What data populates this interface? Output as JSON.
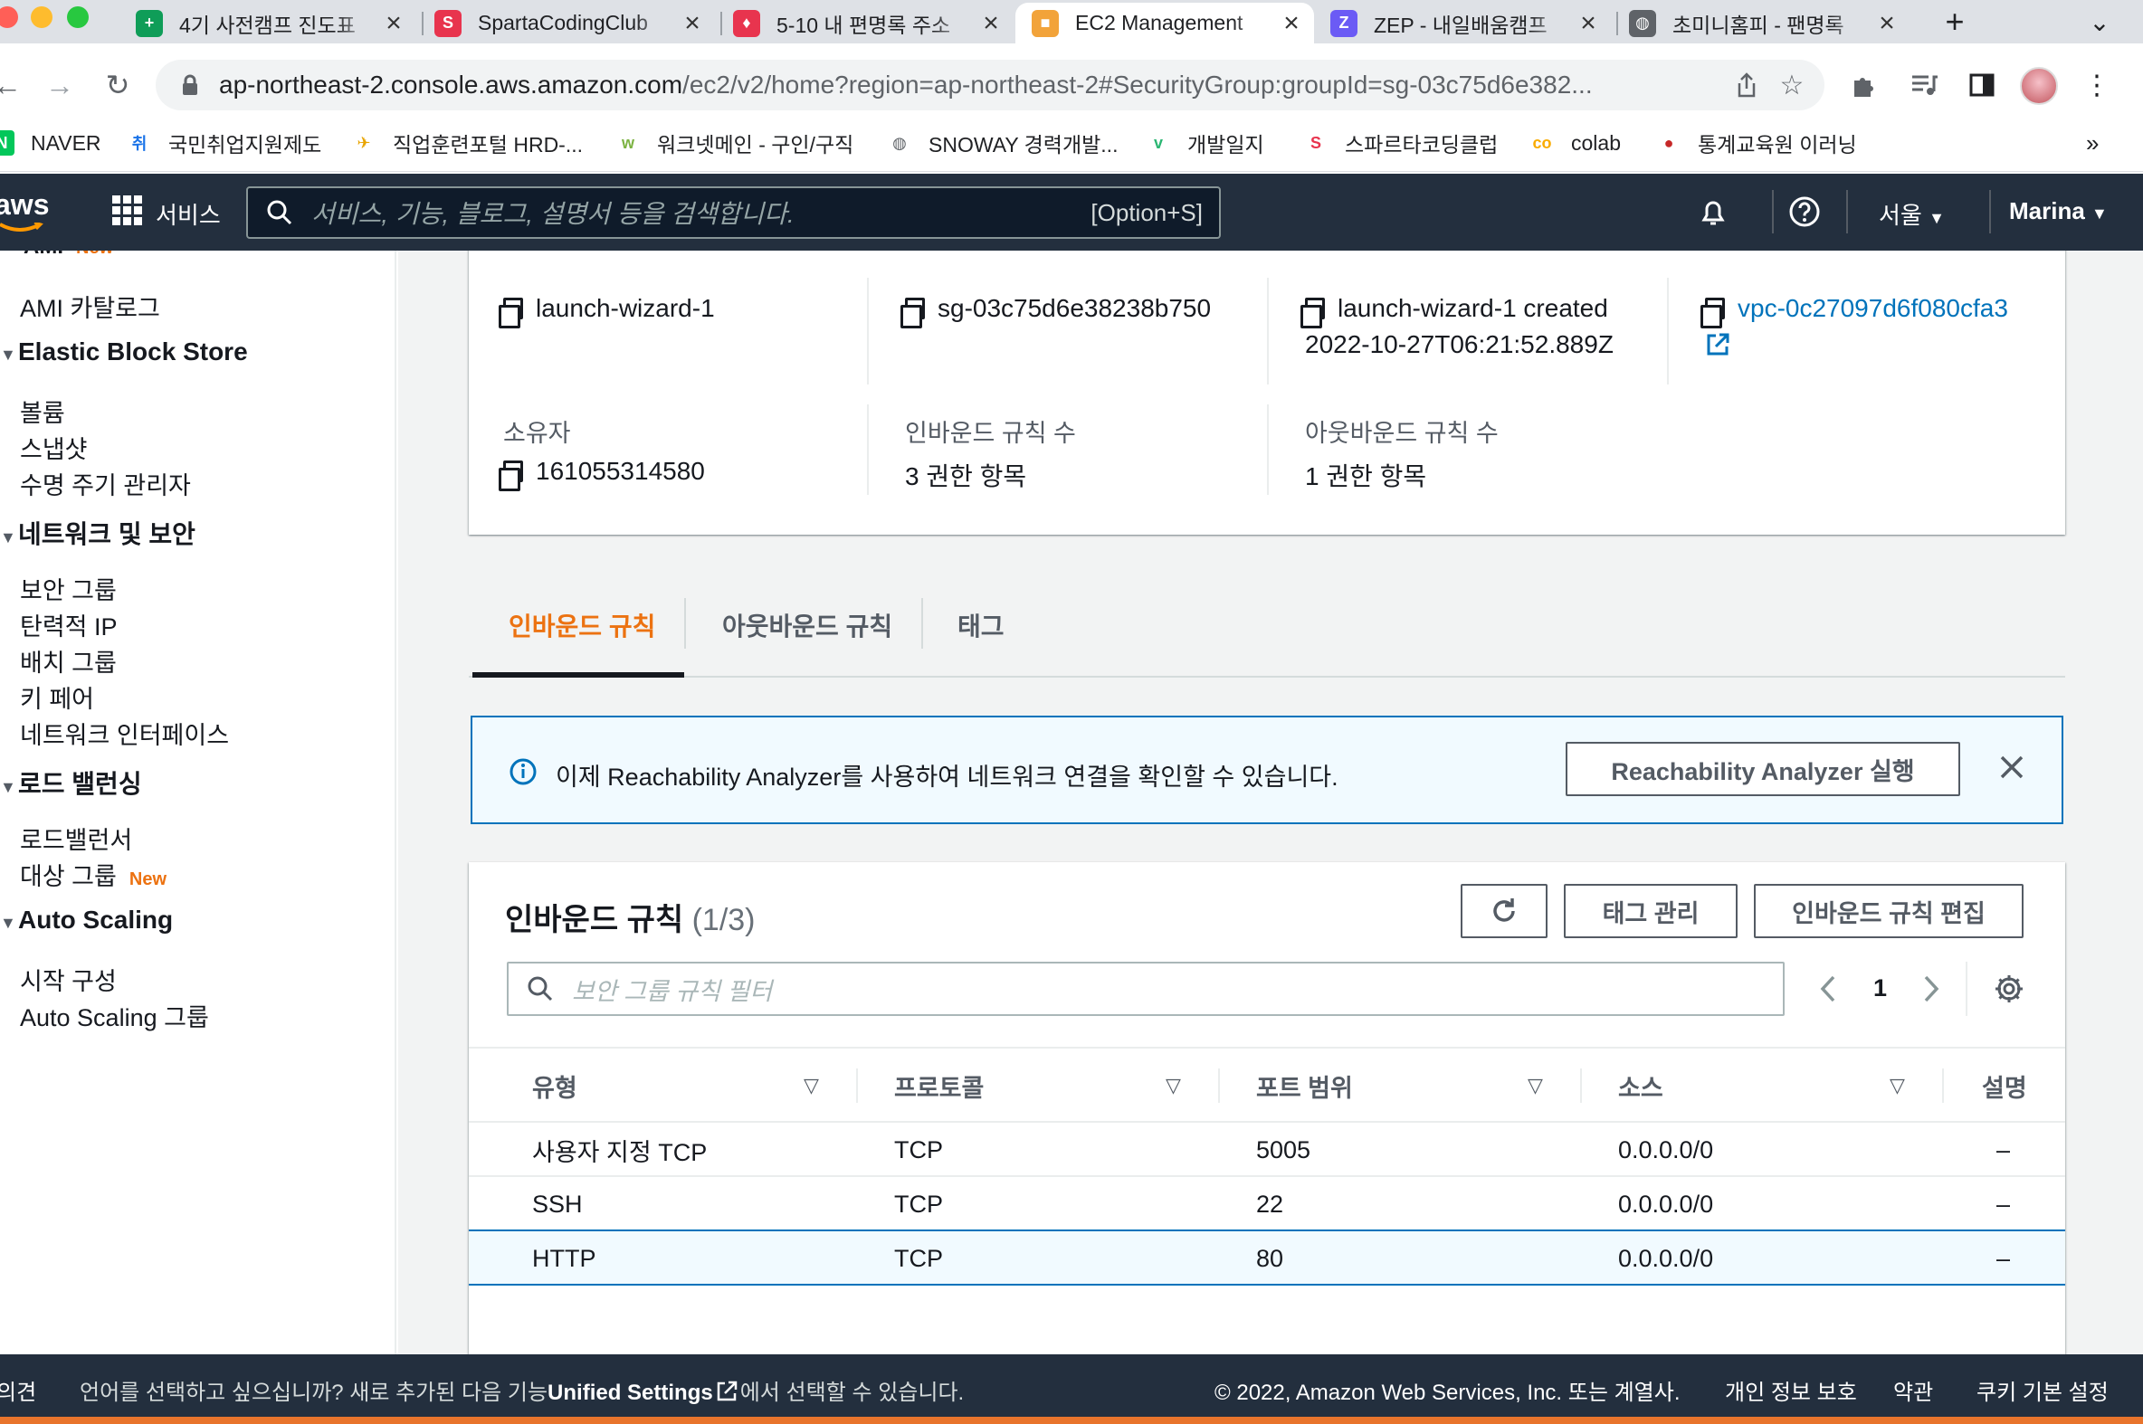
{
  "browser": {
    "tabs": [
      {
        "title": "4기 사전캠프 진도표",
        "favicon_color": "#0f9d58",
        "favicon_text": "+",
        "active": false
      },
      {
        "title": "SpartaCodingClub",
        "favicon_color": "#e8344e",
        "favicon_text": "S",
        "active": false
      },
      {
        "title": "5-10 내 편명록 주소",
        "favicon_color": "#e8344e",
        "favicon_text": "♦",
        "active": false
      },
      {
        "title": "EC2 Management",
        "favicon_color": "#f2a33a",
        "favicon_text": "■",
        "active": true
      },
      {
        "title": "ZEP - 내일배움캠프",
        "favicon_color": "#6b5bf5",
        "favicon_text": "Z",
        "active": false
      },
      {
        "title": "초미니홈피 - 팬명록",
        "favicon_color": "#5f6368",
        "favicon_text": "◍",
        "active": false
      }
    ],
    "new_tab": "+",
    "tab_menu": "⌄",
    "url_host": "ap-northeast-2.console.aws.amazon.com",
    "url_path": "/ec2/v2/home?region=ap-northeast-2#SecurityGroup:groupId=sg-03c75d6e382...",
    "bookmarks": [
      {
        "label": "NAVER",
        "icon": "N",
        "color": "#03c75a"
      },
      {
        "label": "국민취업지원제도",
        "icon": "취",
        "color": "#1a73e8"
      },
      {
        "label": "직업훈련포털 HRD-...",
        "icon": "✈",
        "color": "#e8a400"
      },
      {
        "label": "워크넷메인 - 구인/구직",
        "icon": "w",
        "color": "#7cb342"
      },
      {
        "label": "SNOWAY 경력개발...",
        "icon": "◍",
        "color": "#5f6368"
      },
      {
        "label": "개발일지",
        "icon": "v",
        "color": "#2bb673"
      },
      {
        "label": "스파르타코딩클럽",
        "icon": "S",
        "color": "#e8344e"
      },
      {
        "label": "colab",
        "icon": "co",
        "color": "#f9ab00"
      },
      {
        "label": "통계교육원 이러닝",
        "icon": "●",
        "color": "#c62828"
      }
    ],
    "bookmarks_more": "»"
  },
  "aws_nav": {
    "logo": "aws",
    "services_label": "서비스",
    "search_placeholder": "서비스, 기능, 블로그, 설명서 등을 검색합니다.",
    "search_shortcut": "[Option+S]",
    "region": "서울",
    "user": "Marina"
  },
  "sidebar": {
    "partial_top": "AMI",
    "partial_top_badge": "New",
    "items": [
      {
        "type": "item",
        "label": "AMI 카탈로그"
      },
      {
        "type": "head",
        "label": "Elastic Block Store"
      },
      {
        "type": "item",
        "label": "볼륨"
      },
      {
        "type": "item",
        "label": "스냅샷"
      },
      {
        "type": "item",
        "label": "수명 주기 관리자"
      },
      {
        "type": "head",
        "label": "네트워크 및 보안"
      },
      {
        "type": "item",
        "label": "보안 그룹"
      },
      {
        "type": "item",
        "label": "탄력적 IP"
      },
      {
        "type": "item",
        "label": "배치 그룹"
      },
      {
        "type": "item",
        "label": "키 페어"
      },
      {
        "type": "item",
        "label": "네트워크 인터페이스"
      },
      {
        "type": "head",
        "label": "로드 밸런싱"
      },
      {
        "type": "item",
        "label": "로드밸런서"
      },
      {
        "type": "item",
        "label": "대상 그룹",
        "badge": "New"
      },
      {
        "type": "head",
        "label": "Auto Scaling"
      },
      {
        "type": "item",
        "label": "시작 구성"
      },
      {
        "type": "item",
        "label": "Auto Scaling 그룹"
      }
    ]
  },
  "details": {
    "group_name": "launch-wizard-1",
    "group_id": "sg-03c75d6e38238b750",
    "description_line1": "launch-wizard-1 created",
    "description_line2": "2022-10-27T06:21:52.889Z",
    "vpc_id": "vpc-0c27097d6f080cfa3",
    "owner_label": "소유자",
    "owner": "161055314580",
    "inbound_count_label": "인바운드 규칙 수",
    "inbound_count": "3 권한 항목",
    "outbound_count_label": "아웃바운드 규칙 수",
    "outbound_count": "1 권한 항목"
  },
  "tabs": {
    "inbound": "인바운드 규칙",
    "outbound": "아웃바운드 규칙",
    "tags": "태그"
  },
  "info_banner": {
    "text": "이제 Reachability Analyzer를 사용하여 네트워크 연결을 확인할 수 있습니다.",
    "button": "Reachability Analyzer 실행"
  },
  "rules_panel": {
    "title": "인바운드 규칙",
    "count": "(1/3)",
    "manage_tags": "태그 관리",
    "edit_rules": "인바운드 규칙 편집",
    "filter_placeholder": "보안 그룹 규칙 필터",
    "page": "1",
    "columns": [
      "유형",
      "프로토콜",
      "포트 범위",
      "소스",
      "설명"
    ],
    "rows": [
      {
        "type": "사용자 지정 TCP",
        "protocol": "TCP",
        "port": "5005",
        "source": "0.0.0.0/0",
        "desc": "–",
        "selected": false
      },
      {
        "type": "SSH",
        "protocol": "TCP",
        "port": "22",
        "source": "0.0.0.0/0",
        "desc": "–",
        "selected": false
      },
      {
        "type": "HTTP",
        "protocol": "TCP",
        "port": "80",
        "source": "0.0.0.0/0",
        "desc": "–",
        "selected": true
      }
    ]
  },
  "footer": {
    "feedback": "의견",
    "lang_text_pre": "언어를 선택하고 싶으십니까? 새로 추가된 다음 기능",
    "lang_link": "Unified Settings",
    "lang_text_post": "에서 선택할 수 있습니다.",
    "copyright": "© 2022, Amazon Web Services, Inc. 또는 계열사.",
    "privacy": "개인 정보 보호",
    "terms": "약관",
    "cookies": "쿠키 기본 설정"
  },
  "colors": {
    "aws_dark": "#232f3e",
    "accent_orange": "#ec7211",
    "link_blue": "#0073bb",
    "info_blue": "#0073bb",
    "info_bg": "#f1faff",
    "selected_row_bg": "#f1faff"
  }
}
